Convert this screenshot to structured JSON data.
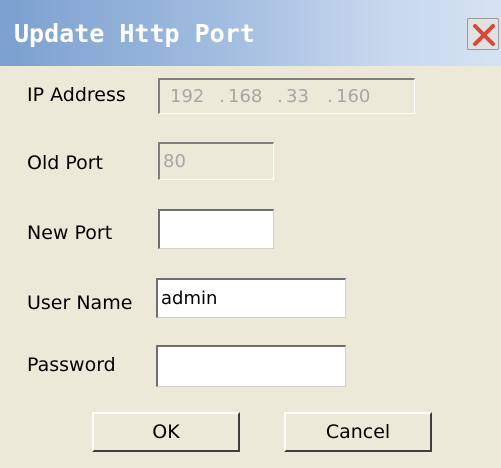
{
  "window": {
    "title": "Update Http Port",
    "close_icon": "close-icon"
  },
  "form": {
    "ip_label": "IP Address",
    "ip_octets": [
      "192",
      "168",
      "33",
      "160"
    ],
    "old_port_label": "Old Port",
    "old_port_value": "80",
    "new_port_label": "New Port",
    "new_port_value": "",
    "username_label": "User Name",
    "username_value": "admin",
    "password_label": "Password",
    "password_value": ""
  },
  "buttons": {
    "ok": "OK",
    "cancel": "Cancel"
  },
  "colors": {
    "title_gradient_start": "#7ba0cf",
    "title_gradient_end": "#d5e2f1",
    "dialog_bg": "#ece9d8",
    "close_x": "#d6483a"
  }
}
